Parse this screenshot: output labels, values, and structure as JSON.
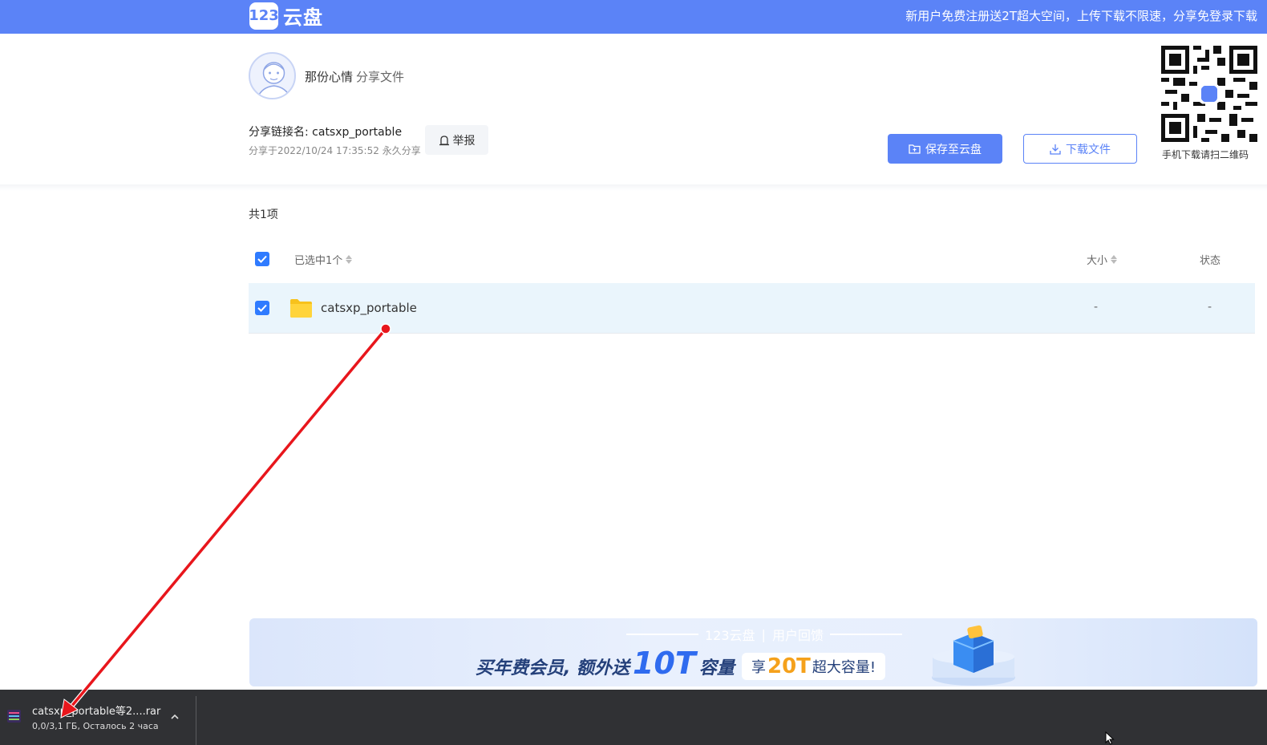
{
  "topbar": {
    "logo_badge": "123",
    "logo_text": "云盘",
    "promo": "新用户免费注册送2T超大空间，上传下载不限速，分享免登录下载"
  },
  "share": {
    "user_name": "那份心情",
    "user_action": "分享文件",
    "link_title": "分享链接名: catsxp_portable",
    "link_meta": "分享于2022/10/24 17:35:52 永久分享",
    "report_label": "举报",
    "save_label": "保存至云盘",
    "download_label": "下载文件",
    "qr_caption": "手机下载请扫二维码"
  },
  "list": {
    "count_label": "共1项",
    "header": {
      "name": "已选中1个",
      "size": "大小",
      "status": "状态"
    },
    "rows": [
      {
        "name": "catsxp_portable",
        "size": "-",
        "status": "-",
        "type": "folder",
        "selected": true
      }
    ]
  },
  "banner": {
    "brand": "123云盘",
    "tag": "用户回馈",
    "text_prefix": "买年费会员, 额外送",
    "highlight": "10T",
    "text_suffix": "容量",
    "chip_prefix": "享",
    "chip_highlight": "20T",
    "chip_suffix": "超大容量!"
  },
  "download_bar": {
    "file_name": "catsxp_portable等2....rar",
    "status": "0,0/3,1 ГБ, Осталось 2 часа"
  },
  "colors": {
    "brand_blue": "#5b83f7",
    "checkbox_blue": "#2f7bff",
    "row_selected": "#eaf5fc",
    "download_bar": "#303134",
    "annotation_red": "#e8161c"
  }
}
